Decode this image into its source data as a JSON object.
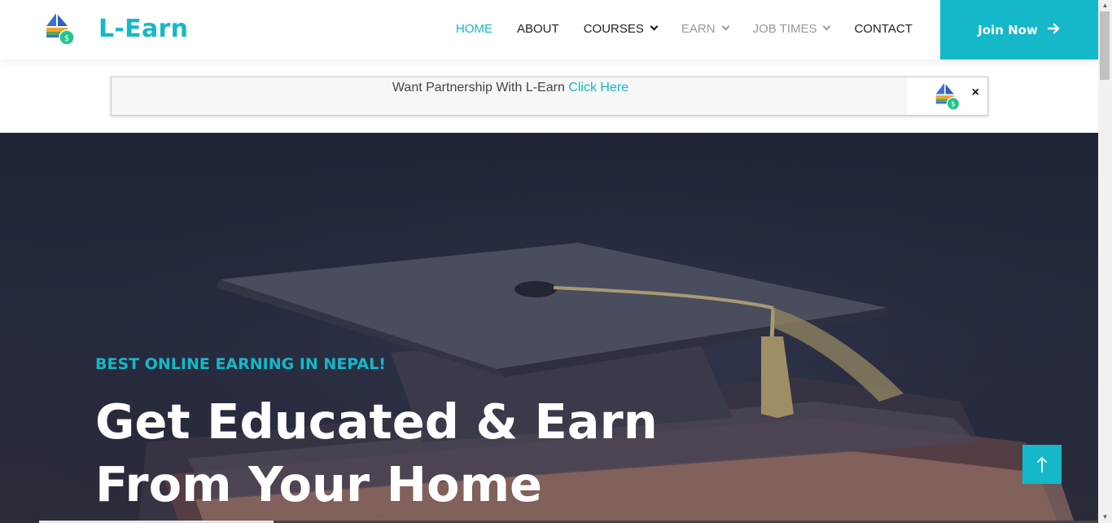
{
  "header": {
    "brand": "L-Earn",
    "nav": [
      {
        "label": "HOME",
        "state": "active"
      },
      {
        "label": "ABOUT",
        "state": "normal"
      },
      {
        "label": "COURSES",
        "state": "dropdown"
      },
      {
        "label": "EARN",
        "state": "dropdown-muted"
      },
      {
        "label": "JOB TIMES",
        "state": "dropdown-muted"
      },
      {
        "label": "CONTACT",
        "state": "normal"
      }
    ],
    "join_label": "Join Now",
    "join_icon": "arrow-right-icon"
  },
  "banner": {
    "text": "Want Partnership With L-Earn",
    "link_text": "Click Here",
    "close_label": "×"
  },
  "hero": {
    "subtitle": "BEST ONLINE EARNING IN NEPAL!",
    "title_line1": "Get Educated & Earn",
    "title_line2": "From Your Home",
    "to_top_icon": "arrow-up-icon"
  },
  "colors": {
    "accent": "#14b8c8",
    "hero_bg": "#22263a",
    "text_dark": "#222222",
    "text_muted": "#9a9a9a"
  }
}
